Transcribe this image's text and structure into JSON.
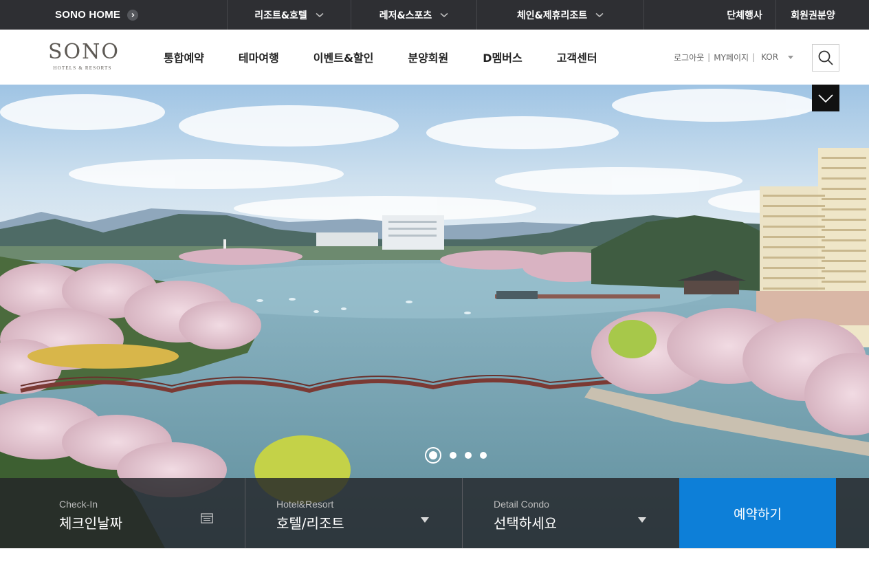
{
  "topbar": {
    "home_label": "SONO HOME",
    "menus": [
      {
        "label": "리조트&호텔"
      },
      {
        "label": "레저&스포츠"
      },
      {
        "label": "체인&제휴리조트"
      }
    ],
    "right_links": [
      {
        "label": "단체행사"
      },
      {
        "label": "회원권분양"
      }
    ]
  },
  "header": {
    "logo_mark": "SONO",
    "logo_sub": "HOTELS & RESORTS",
    "nav": [
      {
        "label": "통합예약"
      },
      {
        "label": "테마여행"
      },
      {
        "label": "이벤트&할인"
      },
      {
        "label": "분양회원"
      },
      {
        "label": "D멤버스"
      },
      {
        "label": "고객센터"
      }
    ],
    "util": {
      "logout": "로그아웃",
      "mypage": "MY페이지",
      "separator": "|",
      "lang": "KOR"
    }
  },
  "hero": {
    "slide_count": 4,
    "active_slide": 1
  },
  "booking": {
    "checkin_label": "Check-In",
    "checkin_value": "체크인날짜",
    "hotel_label": "Hotel&Resort",
    "hotel_value": "호텔/리조트",
    "condo_label": "Detail Condo",
    "condo_value": "선택하세요",
    "reserve_label": "예약하기"
  },
  "colors": {
    "topbar_bg": "#2e2f33",
    "reserve_bg": "#0d7fd8",
    "booking_bg": "#232428"
  }
}
